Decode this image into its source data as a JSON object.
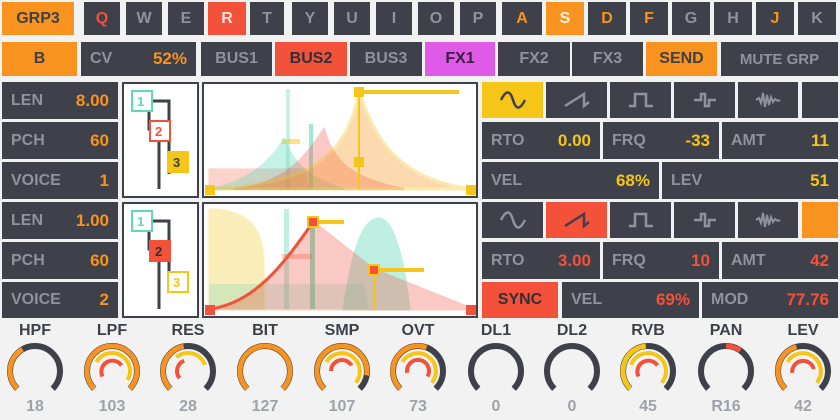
{
  "keyrow": {
    "group_label": "GRP3",
    "keys": [
      {
        "label": "Q",
        "state": "red-text"
      },
      {
        "label": "W",
        "state": "off"
      },
      {
        "label": "E",
        "state": "off"
      },
      {
        "label": "R",
        "state": "red"
      },
      {
        "label": "T",
        "state": "off"
      },
      {
        "label": "Y",
        "state": "off"
      },
      {
        "label": "U",
        "state": "off"
      },
      {
        "label": "I",
        "state": "off"
      },
      {
        "label": "O",
        "state": "off"
      },
      {
        "label": "P",
        "state": "off"
      },
      {
        "label": "A",
        "state": "orange-text"
      },
      {
        "label": "S",
        "state": "orange"
      },
      {
        "label": "D",
        "state": "orange-text"
      },
      {
        "label": "F",
        "state": "orange-text"
      },
      {
        "label": "G",
        "state": "off"
      },
      {
        "label": "H",
        "state": "off"
      },
      {
        "label": "J",
        "state": "orange-text"
      },
      {
        "label": "K",
        "state": "off"
      }
    ]
  },
  "busrow": {
    "b_label": "B",
    "cv_label": "CV",
    "cv_value": "52%",
    "buses": [
      {
        "label": "BUS1",
        "state": "off"
      },
      {
        "label": "BUS2",
        "state": "red"
      },
      {
        "label": "BUS3",
        "state": "off"
      },
      {
        "label": "FX1",
        "state": "purple"
      },
      {
        "label": "FX2",
        "state": "off"
      },
      {
        "label": "FX3",
        "state": "off"
      }
    ],
    "send_label": "SEND",
    "mute_label": "MUTE GRP"
  },
  "voice1": {
    "len_label": "LEN",
    "len_value": "8.00",
    "pch_label": "PCH",
    "pch_value": "60",
    "voice_label": "VOICE",
    "voice_value": "1",
    "routing": [
      "1",
      "2",
      "3"
    ],
    "wave_selected": 0,
    "rto_label": "RTO",
    "rto_value": "0.00",
    "frq_label": "FRQ",
    "frq_value": "-33",
    "amt_label": "AMT",
    "amt_value": "11",
    "vel_label": "VEL",
    "vel_value": "68%",
    "lev_label": "LEV",
    "lev_value": "51"
  },
  "voice2": {
    "len_label": "LEN",
    "len_value": "1.00",
    "pch_label": "PCH",
    "pch_value": "60",
    "voice_label": "VOICE",
    "voice_value": "2",
    "routing": [
      "1",
      "2",
      "3"
    ],
    "wave_selected": 1,
    "rto_label": "RTO",
    "rto_value": "3.00",
    "frq_label": "FRQ",
    "frq_value": "10",
    "amt_label": "AMT",
    "amt_value": "42",
    "sync_label": "SYNC",
    "vel_label": "VEL",
    "vel_value": "69%",
    "mod_label": "MOD",
    "mod_value": "77.76"
  },
  "wave_icons": [
    "sine-icon",
    "saw-icon",
    "square-icon",
    "pulse-icon",
    "noise-icon",
    "blank"
  ],
  "knobs": [
    {
      "label": "HPF",
      "value": "18"
    },
    {
      "label": "LPF",
      "value": "103"
    },
    {
      "label": "RES",
      "value": "28"
    },
    {
      "label": "BIT",
      "value": "127"
    },
    {
      "label": "SMP",
      "value": "107"
    },
    {
      "label": "OVT",
      "value": "73"
    },
    {
      "label": "DL1",
      "value": "0"
    },
    {
      "label": "DL2",
      "value": "0"
    },
    {
      "label": "RVB",
      "value": "45"
    },
    {
      "label": "PAN",
      "value": "R16"
    },
    {
      "label": "LEV",
      "value": "42"
    }
  ],
  "colors": {
    "dark": "#3e4149",
    "orange": "#f7931e",
    "red": "#f4513b",
    "yellow": "#f5c518",
    "teal": "#5fd8b8",
    "purple": "#e05ae8"
  }
}
